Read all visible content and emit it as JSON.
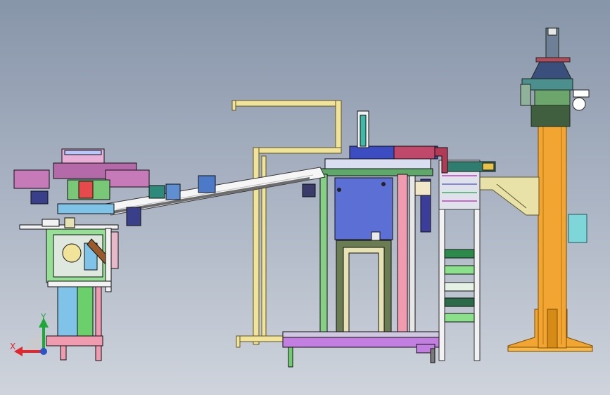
{
  "viewport": {
    "background_top": "#8795a9",
    "background_bottom": "#cfd4dc"
  },
  "triad": {
    "x_label": "X",
    "y_label": "Y",
    "x_color": "#e0262f",
    "y_color": "#1ea83a",
    "z_color": "#2b53c8"
  },
  "palette": {
    "yellow_frame": "#f1e49a",
    "orange_column": "#f3a531",
    "purple_base": "#c27ee0",
    "green_frame": "#7ed07e",
    "pink": "#f09bb0",
    "blue_block": "#5b6fd4",
    "light_blue": "#7fc4e8",
    "white_frame": "#f2f2f2"
  }
}
